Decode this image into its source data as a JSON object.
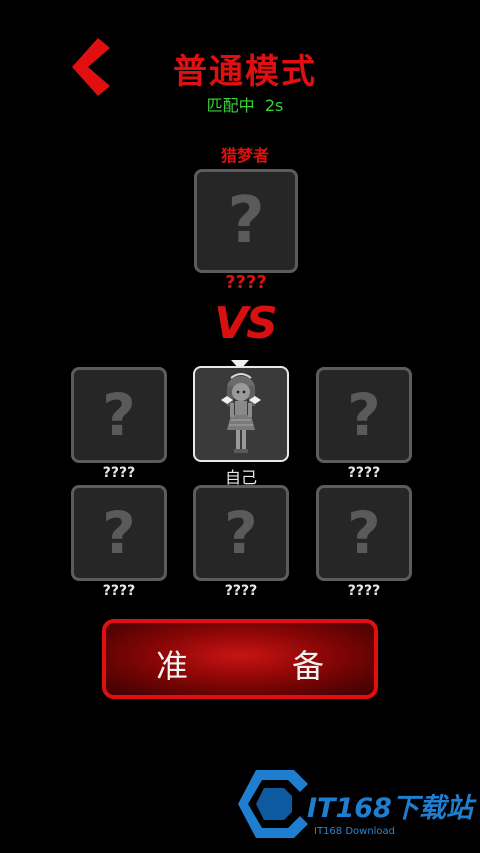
{
  "header": {
    "title": "普通模式",
    "status": "匹配中  2s"
  },
  "opponent": {
    "role": "猎梦者",
    "name": "????",
    "placeholder_glyph": "?"
  },
  "vs_text": "VS",
  "team": {
    "slots": [
      {
        "name": "????",
        "glyph": "?"
      },
      {
        "name": "自己",
        "glyph": ""
      },
      {
        "name": "????",
        "glyph": "?"
      },
      {
        "name": "????",
        "glyph": "?"
      },
      {
        "name": "????",
        "glyph": "?"
      },
      {
        "name": "????",
        "glyph": "?"
      }
    ]
  },
  "ready_button": {
    "left_char": "准",
    "right_char": "备"
  },
  "watermark": {
    "text": "IT168下载站",
    "sub": "IT168 Download"
  },
  "colors": {
    "accent_red": "#e01010",
    "status_green": "#3ad33a",
    "watermark_blue": "#1e7fd0"
  },
  "icons": {
    "back": "chevron-left-icon",
    "self_avatar": "girl-avatar-icon"
  }
}
